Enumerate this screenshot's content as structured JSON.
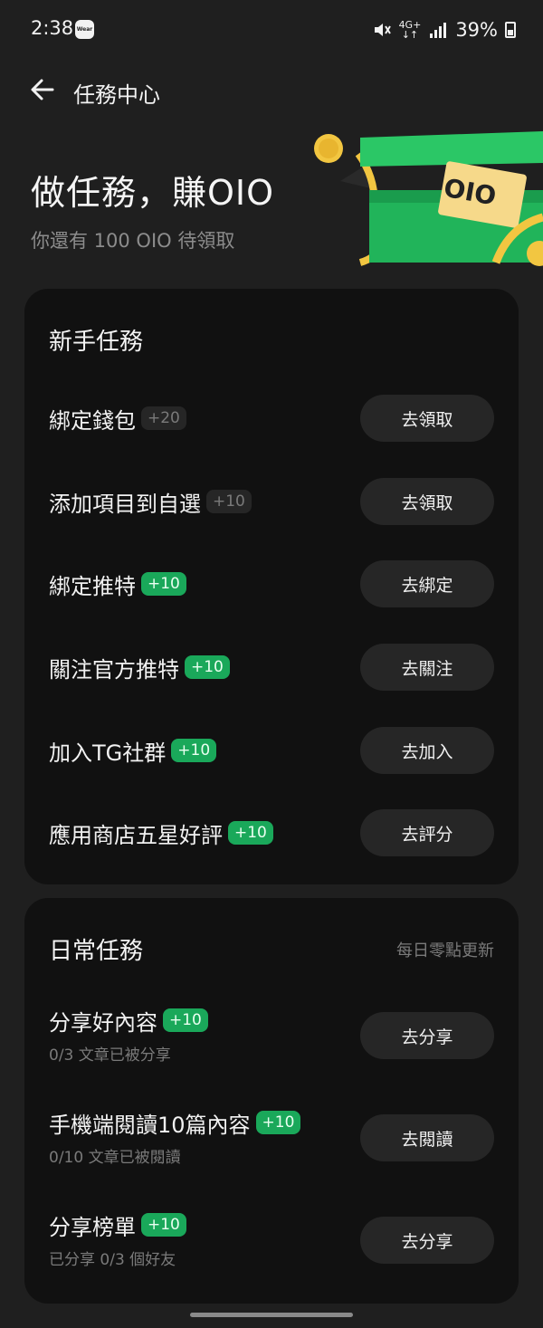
{
  "status_bar": {
    "time": "2:38",
    "wear_badge": "Wear",
    "network": "4G+",
    "battery": "39%"
  },
  "header": {
    "title": "任務中心"
  },
  "hero": {
    "title": "做任務，賺OIO",
    "subtitle": "你還有 100 OIO 待領取",
    "art_label": "OIO"
  },
  "newbie": {
    "title": "新手任務",
    "tasks": [
      {
        "name": "綁定錢包",
        "reward": "+20",
        "button": "去領取"
      },
      {
        "name": "添加項目到自選",
        "reward": "+10",
        "button": "去領取"
      },
      {
        "name": "綁定推特",
        "reward": "+10",
        "button": "去綁定"
      },
      {
        "name": "關注官方推特",
        "reward": "+10",
        "button": "去關注"
      },
      {
        "name": "加入TG社群",
        "reward": "+10",
        "button": "去加入"
      },
      {
        "name": "應用商店五星好評",
        "reward": "+10",
        "button": "去評分"
      }
    ]
  },
  "daily": {
    "title": "日常任務",
    "note": "每日零點更新",
    "tasks": [
      {
        "name": "分享好內容",
        "reward": "+10",
        "sub": "0/3 文章已被分享",
        "button": "去分享"
      },
      {
        "name": "手機端閱讀10篇內容",
        "reward": "+10",
        "sub": "0/10 文章已被閱讀",
        "button": "去閱讀"
      },
      {
        "name": "分享榜單",
        "reward": "+10",
        "sub": "已分享 0/3 個好友",
        "button": "去分享"
      }
    ]
  },
  "colors": {
    "background": "#1f1f1f",
    "card": "#111111",
    "button": "#262626",
    "accent_green": "#1aa85a"
  }
}
